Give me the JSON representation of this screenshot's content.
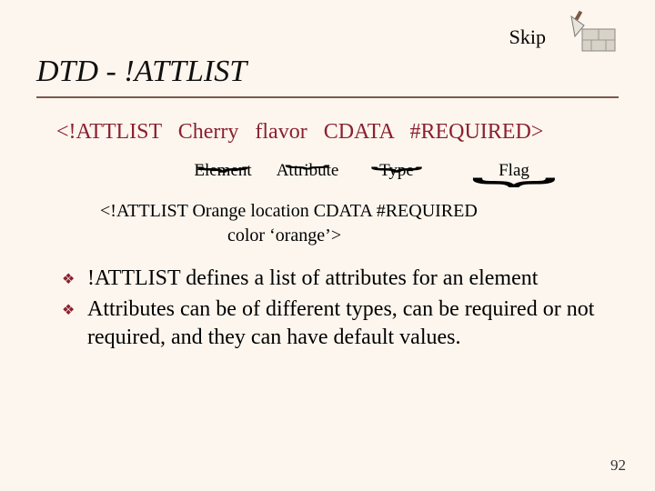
{
  "skip_label": "Skip",
  "title": "DTD - !ATTLIST",
  "syntax_line": "<!ATTLIST   Cherry   flavor   CDATA   #REQUIRED>",
  "annotations": {
    "element": "Element",
    "attribute": "Attribute",
    "type": "Type",
    "flag": "Flag"
  },
  "example": {
    "line1": "<!ATTLIST Orange  location CDATA #REQUIRED",
    "line2": "color ‘orange’>"
  },
  "bullets": [
    "!ATTLIST defines a list of attributes for an element",
    "Attributes can be of different types, can be required or not required, and they can have default values."
  ],
  "page_number": "92",
  "icons": {
    "trowel": "trowel-brick-icon",
    "bullet": "diamond-bullet-icon"
  }
}
